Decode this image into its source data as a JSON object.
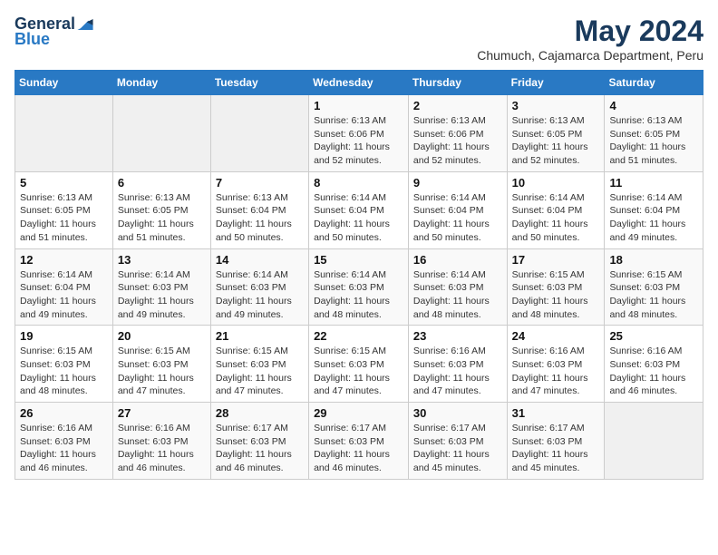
{
  "logo": {
    "general": "General",
    "blue": "Blue"
  },
  "title": {
    "month_year": "May 2024",
    "location": "Chumuch, Cajamarca Department, Peru"
  },
  "headers": [
    "Sunday",
    "Monday",
    "Tuesday",
    "Wednesday",
    "Thursday",
    "Friday",
    "Saturday"
  ],
  "weeks": [
    [
      {
        "day": "",
        "info": ""
      },
      {
        "day": "",
        "info": ""
      },
      {
        "day": "",
        "info": ""
      },
      {
        "day": "1",
        "info": "Sunrise: 6:13 AM\nSunset: 6:06 PM\nDaylight: 11 hours and 52 minutes."
      },
      {
        "day": "2",
        "info": "Sunrise: 6:13 AM\nSunset: 6:06 PM\nDaylight: 11 hours and 52 minutes."
      },
      {
        "day": "3",
        "info": "Sunrise: 6:13 AM\nSunset: 6:05 PM\nDaylight: 11 hours and 52 minutes."
      },
      {
        "day": "4",
        "info": "Sunrise: 6:13 AM\nSunset: 6:05 PM\nDaylight: 11 hours and 51 minutes."
      }
    ],
    [
      {
        "day": "5",
        "info": "Sunrise: 6:13 AM\nSunset: 6:05 PM\nDaylight: 11 hours and 51 minutes."
      },
      {
        "day": "6",
        "info": "Sunrise: 6:13 AM\nSunset: 6:05 PM\nDaylight: 11 hours and 51 minutes."
      },
      {
        "day": "7",
        "info": "Sunrise: 6:13 AM\nSunset: 6:04 PM\nDaylight: 11 hours and 50 minutes."
      },
      {
        "day": "8",
        "info": "Sunrise: 6:14 AM\nSunset: 6:04 PM\nDaylight: 11 hours and 50 minutes."
      },
      {
        "day": "9",
        "info": "Sunrise: 6:14 AM\nSunset: 6:04 PM\nDaylight: 11 hours and 50 minutes."
      },
      {
        "day": "10",
        "info": "Sunrise: 6:14 AM\nSunset: 6:04 PM\nDaylight: 11 hours and 50 minutes."
      },
      {
        "day": "11",
        "info": "Sunrise: 6:14 AM\nSunset: 6:04 PM\nDaylight: 11 hours and 49 minutes."
      }
    ],
    [
      {
        "day": "12",
        "info": "Sunrise: 6:14 AM\nSunset: 6:04 PM\nDaylight: 11 hours and 49 minutes."
      },
      {
        "day": "13",
        "info": "Sunrise: 6:14 AM\nSunset: 6:03 PM\nDaylight: 11 hours and 49 minutes."
      },
      {
        "day": "14",
        "info": "Sunrise: 6:14 AM\nSunset: 6:03 PM\nDaylight: 11 hours and 49 minutes."
      },
      {
        "day": "15",
        "info": "Sunrise: 6:14 AM\nSunset: 6:03 PM\nDaylight: 11 hours and 48 minutes."
      },
      {
        "day": "16",
        "info": "Sunrise: 6:14 AM\nSunset: 6:03 PM\nDaylight: 11 hours and 48 minutes."
      },
      {
        "day": "17",
        "info": "Sunrise: 6:15 AM\nSunset: 6:03 PM\nDaylight: 11 hours and 48 minutes."
      },
      {
        "day": "18",
        "info": "Sunrise: 6:15 AM\nSunset: 6:03 PM\nDaylight: 11 hours and 48 minutes."
      }
    ],
    [
      {
        "day": "19",
        "info": "Sunrise: 6:15 AM\nSunset: 6:03 PM\nDaylight: 11 hours and 48 minutes."
      },
      {
        "day": "20",
        "info": "Sunrise: 6:15 AM\nSunset: 6:03 PM\nDaylight: 11 hours and 47 minutes."
      },
      {
        "day": "21",
        "info": "Sunrise: 6:15 AM\nSunset: 6:03 PM\nDaylight: 11 hours and 47 minutes."
      },
      {
        "day": "22",
        "info": "Sunrise: 6:15 AM\nSunset: 6:03 PM\nDaylight: 11 hours and 47 minutes."
      },
      {
        "day": "23",
        "info": "Sunrise: 6:16 AM\nSunset: 6:03 PM\nDaylight: 11 hours and 47 minutes."
      },
      {
        "day": "24",
        "info": "Sunrise: 6:16 AM\nSunset: 6:03 PM\nDaylight: 11 hours and 47 minutes."
      },
      {
        "day": "25",
        "info": "Sunrise: 6:16 AM\nSunset: 6:03 PM\nDaylight: 11 hours and 46 minutes."
      }
    ],
    [
      {
        "day": "26",
        "info": "Sunrise: 6:16 AM\nSunset: 6:03 PM\nDaylight: 11 hours and 46 minutes."
      },
      {
        "day": "27",
        "info": "Sunrise: 6:16 AM\nSunset: 6:03 PM\nDaylight: 11 hours and 46 minutes."
      },
      {
        "day": "28",
        "info": "Sunrise: 6:17 AM\nSunset: 6:03 PM\nDaylight: 11 hours and 46 minutes."
      },
      {
        "day": "29",
        "info": "Sunrise: 6:17 AM\nSunset: 6:03 PM\nDaylight: 11 hours and 46 minutes."
      },
      {
        "day": "30",
        "info": "Sunrise: 6:17 AM\nSunset: 6:03 PM\nDaylight: 11 hours and 45 minutes."
      },
      {
        "day": "31",
        "info": "Sunrise: 6:17 AM\nSunset: 6:03 PM\nDaylight: 11 hours and 45 minutes."
      },
      {
        "day": "",
        "info": ""
      }
    ]
  ]
}
